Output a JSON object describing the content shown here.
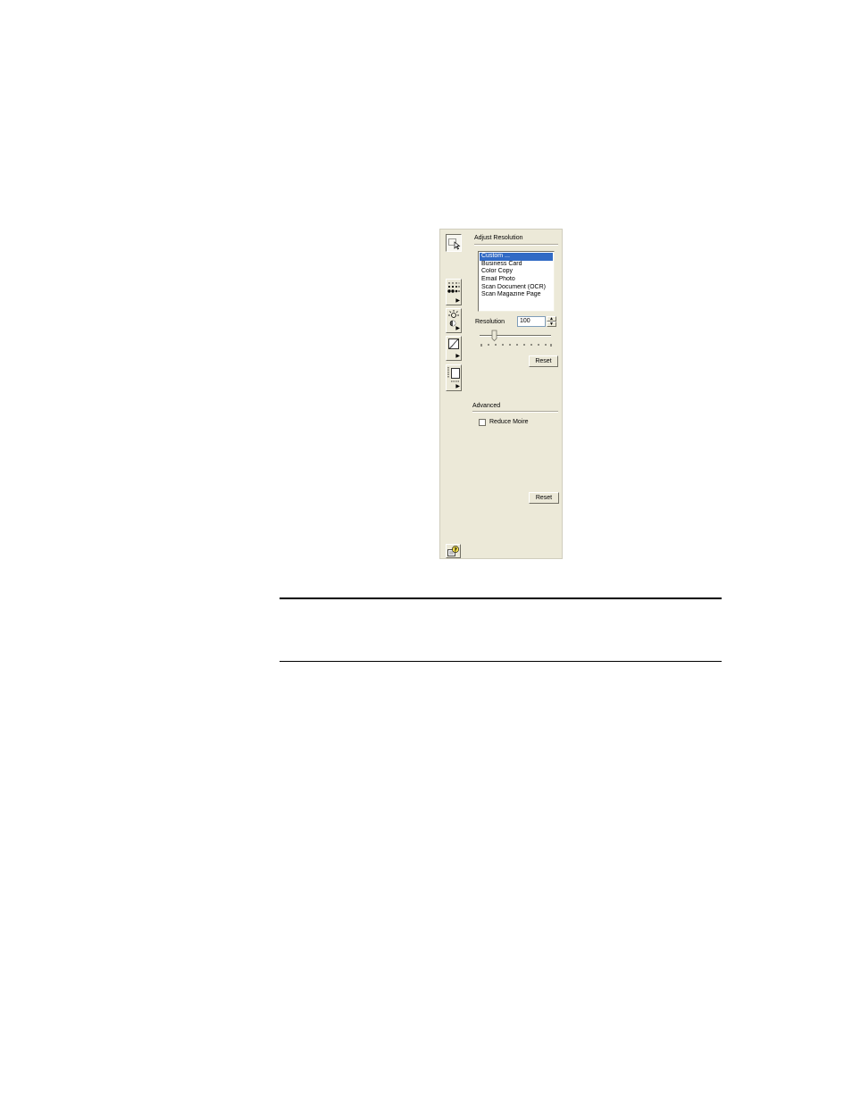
{
  "adjust_resolution": {
    "title": "Adjust Resolution",
    "presets": [
      {
        "label": "Custom ...",
        "selected": true
      },
      {
        "label": "Business Card",
        "selected": false
      },
      {
        "label": "Color Copy",
        "selected": false
      },
      {
        "label": "Email Photo",
        "selected": false
      },
      {
        "label": "Scan Document (OCR)",
        "selected": false
      },
      {
        "label": "Scan Magazine Page",
        "selected": false
      }
    ],
    "resolution_label": "Resolution",
    "resolution_value": "100",
    "reset_label": "Reset"
  },
  "advanced": {
    "title": "Advanced",
    "reduce_moire_label": "Reduce Moire",
    "reduce_moire_checked": false,
    "reset_label": "Reset"
  },
  "toolbar_icons": [
    "select-area-icon",
    "halftone-icon",
    "brightness-icon",
    "color-curve-icon",
    "image-size-icon",
    "help-icon"
  ],
  "colors": {
    "panel_bg": "#ece9d8",
    "selection": "#316ac5"
  }
}
